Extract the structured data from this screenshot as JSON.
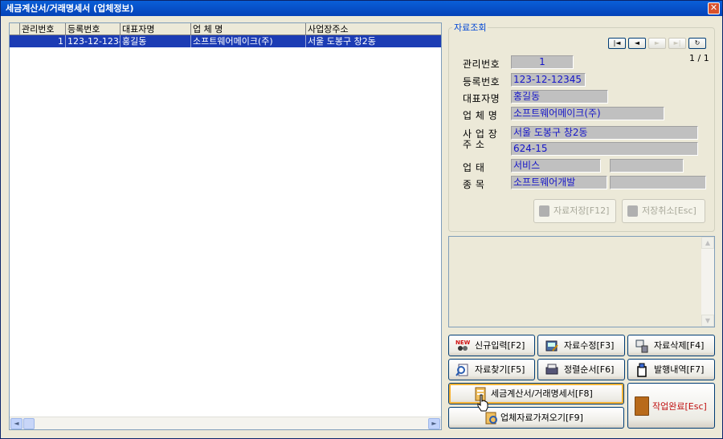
{
  "window": {
    "title": "세금계산서/거래명세서 (업체정보)"
  },
  "grid": {
    "columns": [
      "관리번호",
      "등록번호",
      "대표자명",
      "업 체 명",
      "사업장주소"
    ],
    "rows": [
      {
        "mgmt_no": "1",
        "reg_no": "123-12-12345",
        "rep_name": "홍길동",
        "company": "소프트웨어메이크(주)",
        "address": "서울 도봉구 창2동"
      }
    ]
  },
  "lookup": {
    "legend": "자료조회",
    "nav": {
      "first": "|◄",
      "prev": "◄",
      "next": "►",
      "last": "►|",
      "refresh": "↻"
    },
    "record_count": "1 / 1",
    "labels": {
      "mgmt_no": "관리번호",
      "reg_no": "등록번호",
      "rep_name": "대표자명",
      "company": "업 체 명",
      "address_line1": "사  업  장",
      "address_line2": "주        소",
      "biz_type": "업       태",
      "biz_item": "종       목"
    },
    "values": {
      "mgmt_no": "1",
      "reg_no": "123-12-12345",
      "rep_name": "홍길동",
      "company": "소프트웨어메이크(주)",
      "address1": "서울 도봉구 창2동",
      "address2": "624-15",
      "biz_type": "서비스",
      "biz_type_extra": "",
      "biz_item": "소프트웨어개발",
      "biz_item_extra": ""
    },
    "save_label": "자료저장[F12]",
    "cancel_label": "저장취소[Esc]"
  },
  "actions": {
    "new": "신규입력[F2]",
    "edit": "자료수정[F3]",
    "delete": "자료삭제[F4]",
    "find": "자료찾기[F5]",
    "sort": "정렬순서[F6]",
    "history": "발행내역[F7]",
    "invoice": "세금계산서/거래명세서[F8]",
    "import": "업체자료가져오기[F9]",
    "exit": "작업완료[Esc]"
  },
  "colors": {
    "title_bar": "#0a5fd8",
    "selection": "#1c3cb4",
    "field_text": "#1515c8",
    "exit_text": "#c01010"
  },
  "icons": [
    "close-icon",
    "disk-icon",
    "new-icon",
    "edit-icon",
    "delete-icon",
    "search-icon",
    "sort-icon",
    "history-icon",
    "invoice-icon",
    "import-icon",
    "door-icon",
    "hand-cursor-icon"
  ]
}
